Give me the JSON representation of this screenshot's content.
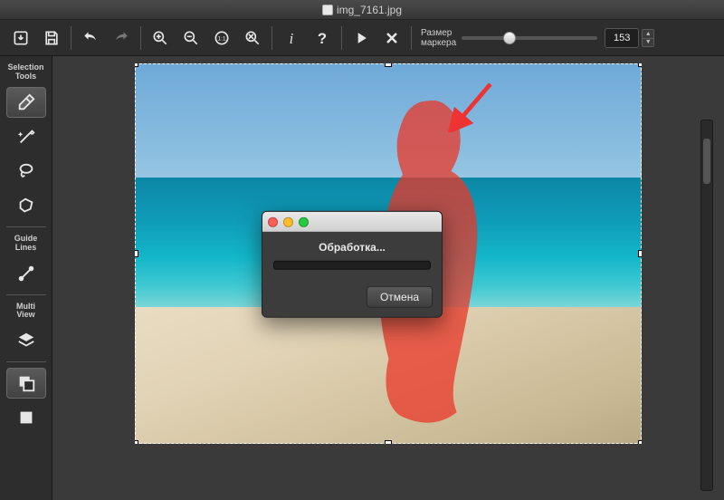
{
  "window": {
    "title": "img_7161.jpg"
  },
  "toolbar": {
    "marker_label": "Размер\nмаркера",
    "marker_value": "153"
  },
  "sidebar": {
    "selection_label": "Selection\nTools",
    "guide_label": "Guide\nLines",
    "multi_label": "Multi\nView"
  },
  "dialog": {
    "title": "Обработка...",
    "cancel": "Отмена"
  }
}
